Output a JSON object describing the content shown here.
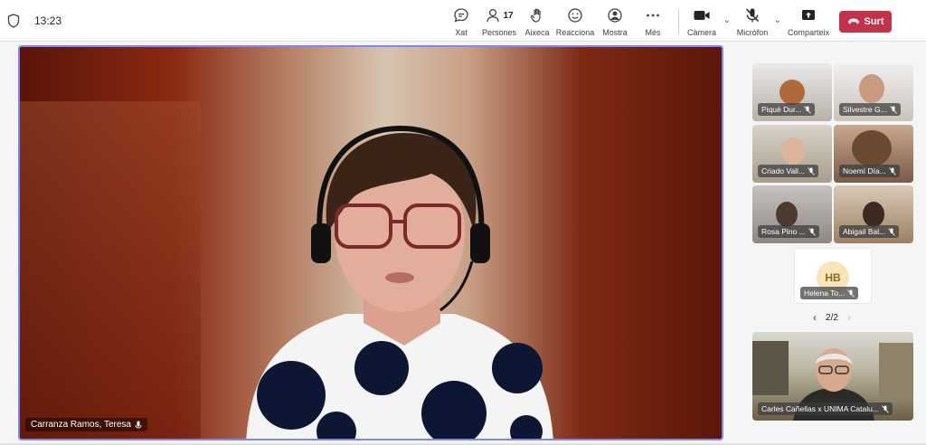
{
  "toolbar": {
    "time": "13:23",
    "buttons": {
      "chat": "Xat",
      "people": "Persones",
      "people_count": "17",
      "raise": "Aixeca",
      "react": "Reacciona",
      "view": "Mostra",
      "more": "Més",
      "camera": "Càmera",
      "mic": "Micròfon",
      "share": "Comparteix"
    },
    "leave_label": "Surt",
    "leave_color": "#c4314b"
  },
  "stage": {
    "speaker_name": "Carranza Ramos, Teresa",
    "accent_color": "#7f85f5"
  },
  "participants": [
    {
      "name": "Piqué Dur..."
    },
    {
      "name": "Silvestre G..."
    },
    {
      "name": "Criado Vall..."
    },
    {
      "name": "Noemí Día..."
    },
    {
      "name": "Rosa Pino ..."
    },
    {
      "name": "Abigail Bal..."
    }
  ],
  "avatar_tile": {
    "initials": "HB",
    "name": "Helena To..."
  },
  "pager": {
    "label": "2/2"
  },
  "big_tile": {
    "name": "Carles Cañellas x UNIMA Catalu..."
  },
  "icons": {
    "security": "shield-icon",
    "chat": "chat-icon",
    "people": "people-icon",
    "raise": "hand-icon",
    "react": "smiley-icon",
    "view": "view-icon",
    "more": "more-icon",
    "camera": "camera-icon",
    "mic": "mic-off-icon",
    "share": "share-icon",
    "leave": "phone-icon"
  }
}
